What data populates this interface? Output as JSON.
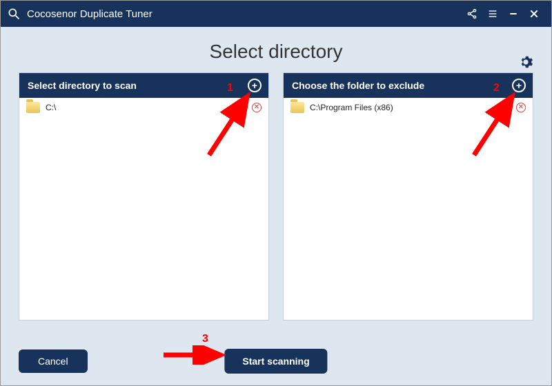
{
  "app": {
    "title": "Cocosenor Duplicate Tuner"
  },
  "page": {
    "title": "Select directory"
  },
  "panels": {
    "scan": {
      "title": "Select directory to scan",
      "items": [
        {
          "path": "C:\\"
        }
      ]
    },
    "exclude": {
      "title": "Choose the folder to exclude",
      "items": [
        {
          "path": "C:\\Program Files (x86)"
        }
      ]
    }
  },
  "buttons": {
    "cancel": "Cancel",
    "start": "Start scanning"
  },
  "annotations": {
    "n1": "1",
    "n2": "2",
    "n3": "3"
  }
}
